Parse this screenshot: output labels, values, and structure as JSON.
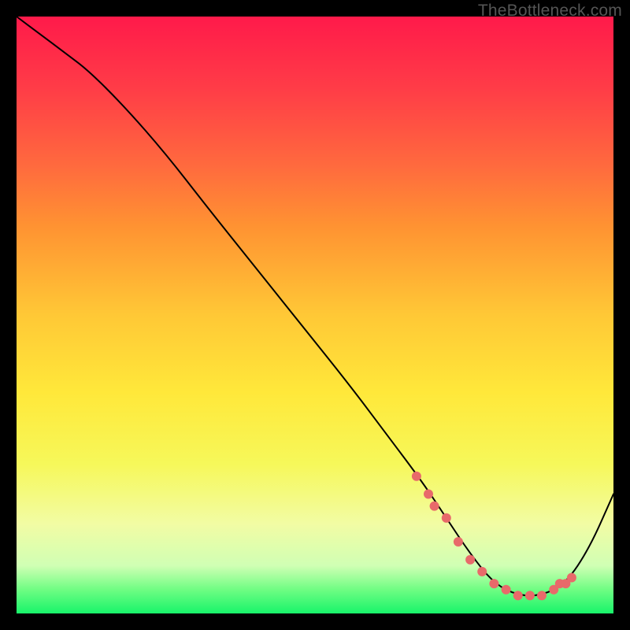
{
  "watermark": "TheBottleneck.com",
  "colors": {
    "dot": "#e86a6a",
    "curve": "#000000",
    "gradient_top": "#ff1a4a",
    "gradient_bottom": "#18f46a"
  },
  "chart_data": {
    "type": "line",
    "title": "",
    "xlabel": "",
    "ylabel": "",
    "xlim": [
      0,
      100
    ],
    "ylim": [
      0,
      100
    ],
    "x": [
      0,
      4,
      8,
      12,
      18,
      25,
      32,
      40,
      48,
      56,
      62,
      68,
      72,
      76,
      80,
      84,
      88,
      92,
      96,
      100
    ],
    "values": [
      100,
      97,
      94,
      91,
      85,
      77,
      68,
      58,
      48,
      38,
      30,
      22,
      16,
      10,
      5,
      3,
      3,
      5,
      11,
      20
    ],
    "series": [
      {
        "name": "highlight-dots",
        "x": [
          67,
          69,
          70,
          72,
          74,
          76,
          78,
          80,
          82,
          84,
          86,
          88,
          90,
          91,
          92,
          93
        ],
        "values": [
          23,
          20,
          18,
          16,
          12,
          9,
          7,
          5,
          4,
          3,
          3,
          3,
          4,
          5,
          5,
          6
        ]
      }
    ]
  }
}
